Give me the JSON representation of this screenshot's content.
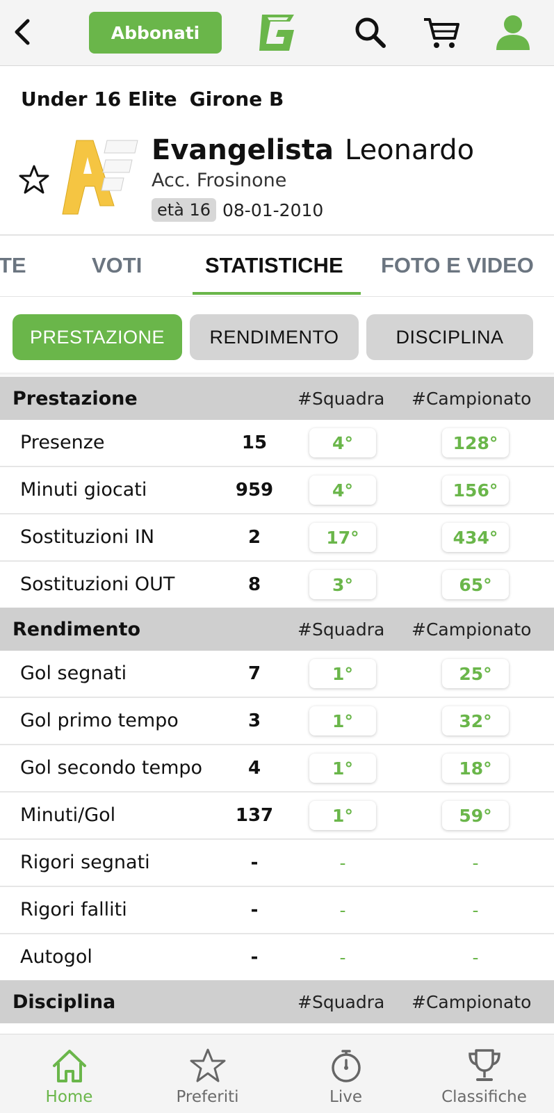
{
  "header": {
    "subscribe_label": "Abbonati",
    "logo_letter": "G"
  },
  "player": {
    "league": "Under 16 Elite",
    "group": "Girone B",
    "surname": "Evangelista",
    "firstname": "Leonardo",
    "team": "Acc. Frosinone",
    "age_label": "età 16",
    "birthdate": "08-01-2010"
  },
  "tabs": [
    {
      "label": "TE",
      "active": false
    },
    {
      "label": "VOTI",
      "active": false
    },
    {
      "label": "STATISTICHE",
      "active": true
    },
    {
      "label": "FOTO E VIDEO",
      "active": false
    }
  ],
  "segments": [
    {
      "label": "PRESTAZIONE",
      "active": true
    },
    {
      "label": "RENDIMENTO",
      "active": false
    },
    {
      "label": "DISCIPLINA",
      "active": false
    }
  ],
  "sections": [
    {
      "title": "Prestazione",
      "col_squadra": "#Squadra",
      "col_campionato": "#Campionato",
      "rows": [
        {
          "label": "Presenze",
          "value": "15",
          "squadra": "4°",
          "campionato": "128°"
        },
        {
          "label": "Minuti giocati",
          "value": "959",
          "squadra": "4°",
          "campionato": "156°"
        },
        {
          "label": "Sostituzioni IN",
          "value": "2",
          "squadra": "17°",
          "campionato": "434°"
        },
        {
          "label": "Sostituzioni OUT",
          "value": "8",
          "squadra": "3°",
          "campionato": "65°"
        }
      ]
    },
    {
      "title": "Rendimento",
      "col_squadra": "#Squadra",
      "col_campionato": "#Campionato",
      "rows": [
        {
          "label": "Gol segnati",
          "value": "7",
          "squadra": "1°",
          "campionato": "25°"
        },
        {
          "label": "Gol primo tempo",
          "value": "3",
          "squadra": "1°",
          "campionato": "32°"
        },
        {
          "label": "Gol secondo tempo",
          "value": "4",
          "squadra": "1°",
          "campionato": "18°"
        },
        {
          "label": "Minuti/Gol",
          "value": "137",
          "squadra": "1°",
          "campionato": "59°"
        },
        {
          "label": "Rigori segnati",
          "value": "-",
          "squadra": "-",
          "campionato": "-"
        },
        {
          "label": "Rigori falliti",
          "value": "-",
          "squadra": "-",
          "campionato": "-"
        },
        {
          "label": "Autogol",
          "value": "-",
          "squadra": "-",
          "campionato": "-"
        }
      ]
    },
    {
      "title": "Disciplina",
      "col_squadra": "#Squadra",
      "col_campionato": "#Campionato",
      "rows": []
    }
  ],
  "bottom_nav": [
    {
      "label": "Home",
      "icon": "home-icon",
      "active": true
    },
    {
      "label": "Preferiti",
      "icon": "star-icon",
      "active": false
    },
    {
      "label": "Live",
      "icon": "stopwatch-icon",
      "active": false
    },
    {
      "label": "Classifiche",
      "icon": "trophy-icon",
      "active": false
    }
  ],
  "colors": {
    "accent": "#6ab64a",
    "section_bg": "#cfcfcf",
    "inactive_tab": "#6b7580"
  }
}
